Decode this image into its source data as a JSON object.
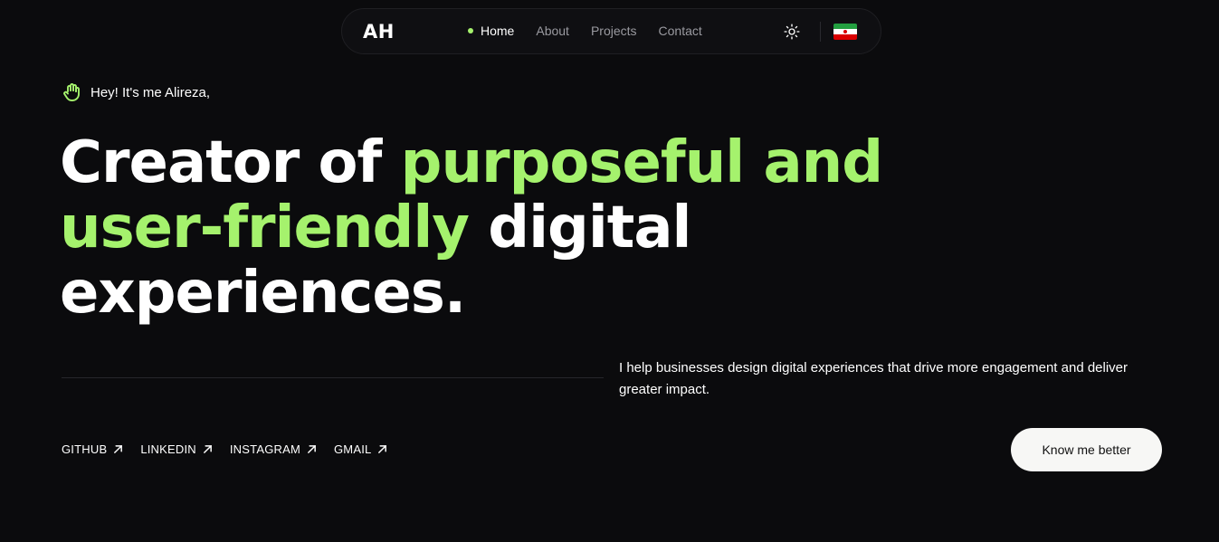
{
  "nav": {
    "logo": "AH",
    "links": [
      {
        "label": "Home",
        "active": true
      },
      {
        "label": "About",
        "active": false
      },
      {
        "label": "Projects",
        "active": false
      },
      {
        "label": "Contact",
        "active": false
      }
    ],
    "theme_icon": "sun-icon",
    "language_icon": "iran-flag-icon"
  },
  "hero": {
    "greeting": "Hey! It's me Alireza,",
    "greeting_icon": "waving-hand-icon",
    "headline": {
      "part1": "Creator of ",
      "accent1": "purposeful and",
      "accent2": "user-friendly",
      "part2": " digital",
      "part3": "experiences."
    },
    "tagline": "I help businesses design digital experiences that drive more engagement and deliver greater impact."
  },
  "socials": [
    {
      "label": "GITHUB",
      "icon": "arrow-up-right-icon"
    },
    {
      "label": "LINKEDIN",
      "icon": "arrow-up-right-icon"
    },
    {
      "label": "INSTAGRAM",
      "icon": "arrow-up-right-icon"
    },
    {
      "label": "GMAIL",
      "icon": "arrow-up-right-icon"
    }
  ],
  "cta": {
    "label": "Know me better"
  },
  "colors": {
    "background": "#0b0b0d",
    "accent": "#a5f26d",
    "text": "#ffffff",
    "muted": "#9a9aa0",
    "button_bg": "#f7f7f5"
  }
}
